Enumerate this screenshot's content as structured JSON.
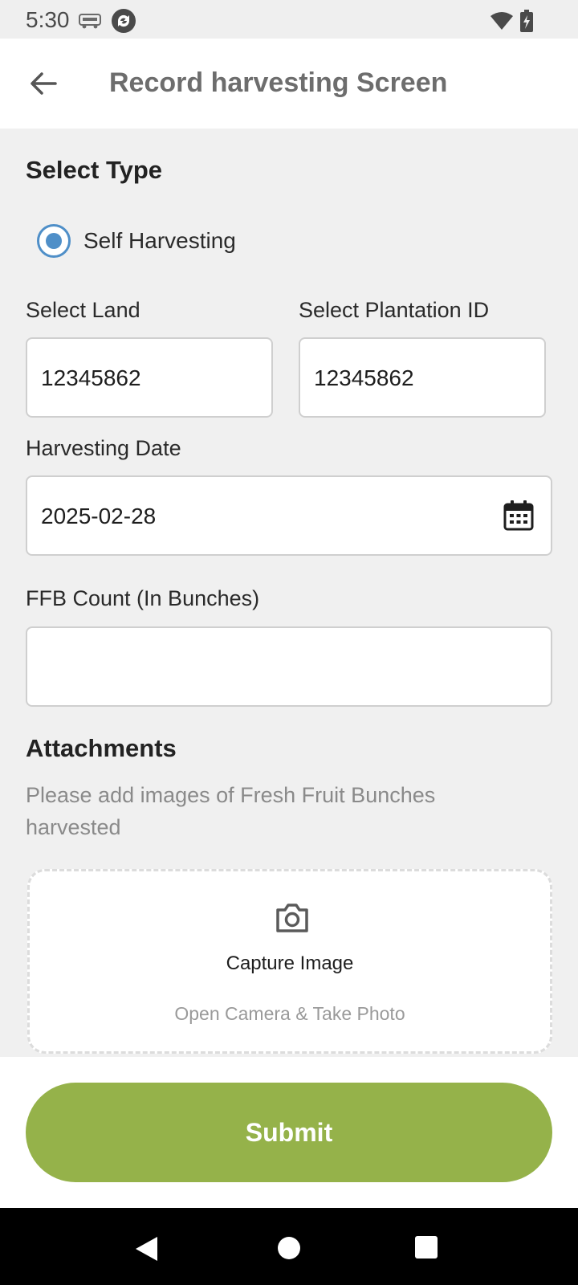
{
  "status_bar": {
    "time": "5:30",
    "icons": [
      "redbus-icon",
      "sync-app-icon",
      "wifi-icon",
      "battery-charging-icon"
    ]
  },
  "app_bar": {
    "back_icon": "arrow-left-icon",
    "title": "Record harvesting Screen"
  },
  "form": {
    "select_type_heading": "Select Type",
    "radio_option_label": "Self Harvesting",
    "radio_selected": true,
    "select_land_label": "Select Land",
    "select_land_value": "12345862",
    "select_plantation_label": "Select Plantation ID",
    "select_plantation_value": "12345862",
    "harvest_date_label": "Harvesting Date",
    "harvest_date_value": "2025-02-28",
    "calendar_icon": "calendar-icon",
    "ffb_count_label": "FFB Count (In Bunches)",
    "ffb_count_value": ""
  },
  "attachments": {
    "heading": "Attachments",
    "hint": "Please add images of Fresh Fruit Bunches harvested",
    "camera_icon": "camera-icon",
    "capture_title": "Capture Image",
    "capture_subtitle": "Open Camera & Take Photo"
  },
  "footer": {
    "submit_label": "Submit"
  },
  "nav_bar": {
    "icons": [
      "back-triangle-icon",
      "home-circle-icon",
      "recents-square-icon"
    ]
  },
  "colors": {
    "accent_green": "#95b24a",
    "radio_blue": "#4f8fc8",
    "background": "#f0f0f0"
  }
}
